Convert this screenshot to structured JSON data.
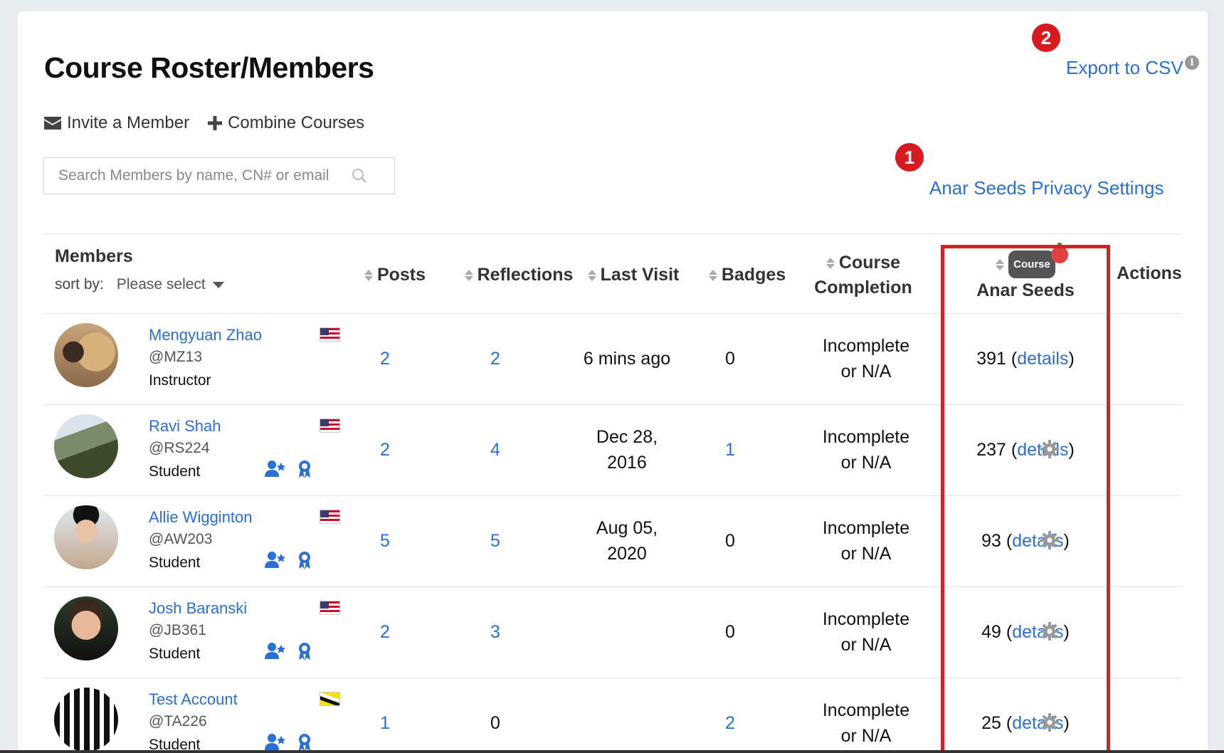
{
  "page": {
    "title": "Course Roster/Members",
    "invite_label": "Invite a Member",
    "combine_label": "Combine Courses",
    "search_placeholder": "Search Members by name, CN# or email",
    "export_label": "Export to CSV",
    "privacy_label": "Anar Seeds Privacy Settings",
    "marker1": "1",
    "marker2": "2"
  },
  "table": {
    "members_header": "Members",
    "sort_by_label": "sort by:",
    "sort_select_value": "Please select",
    "columns": {
      "posts": "Posts",
      "reflections": "Reflections",
      "last_visit": "Last Visit",
      "badges": "Badges",
      "course_completion_1": "Course",
      "course_completion_2": "Completion",
      "course_tag": "Course",
      "anar_seeds": "Anar Seeds",
      "actions": "Actions"
    },
    "details_label": "details",
    "rows": [
      {
        "name": "Mengyuan Zhao",
        "handle": "@MZ13",
        "role": "Instructor",
        "flag": "us",
        "posts": "2",
        "reflections": "2",
        "last_visit_1": "6 mins ago",
        "last_visit_2": "",
        "badges": "0",
        "completion_1": "Incomplete",
        "completion_2": "or N/A",
        "seeds": "391"
      },
      {
        "name": "Ravi Shah",
        "handle": "@RS224",
        "role": "Student",
        "flag": "us",
        "posts": "2",
        "reflections": "4",
        "last_visit_1": "Dec 28,",
        "last_visit_2": "2016",
        "badges": "1",
        "completion_1": "Incomplete",
        "completion_2": "or N/A",
        "seeds": "237"
      },
      {
        "name": "Allie Wigginton",
        "handle": "@AW203",
        "role": "Student",
        "flag": "us",
        "posts": "5",
        "reflections": "5",
        "last_visit_1": "Aug 05,",
        "last_visit_2": "2020",
        "badges": "0",
        "completion_1": "Incomplete",
        "completion_2": "or N/A",
        "seeds": "93"
      },
      {
        "name": "Josh Baranski",
        "handle": "@JB361",
        "role": "Student",
        "flag": "us",
        "posts": "2",
        "reflections": "3",
        "last_visit_1": "",
        "last_visit_2": "",
        "badges": "0",
        "completion_1": "Incomplete",
        "completion_2": "or N/A",
        "seeds": "49"
      },
      {
        "name": "Test Account",
        "handle": "@TA226",
        "role": "Student",
        "flag": "bn",
        "posts": "1",
        "reflections": "0",
        "last_visit_1": "",
        "last_visit_2": "",
        "badges": "2",
        "completion_1": "Incomplete",
        "completion_2": "or N/A",
        "seeds": "25"
      }
    ]
  },
  "colors": {
    "link": "#2a6fd6",
    "highlight": "#d62222",
    "marker": "#d71920"
  }
}
